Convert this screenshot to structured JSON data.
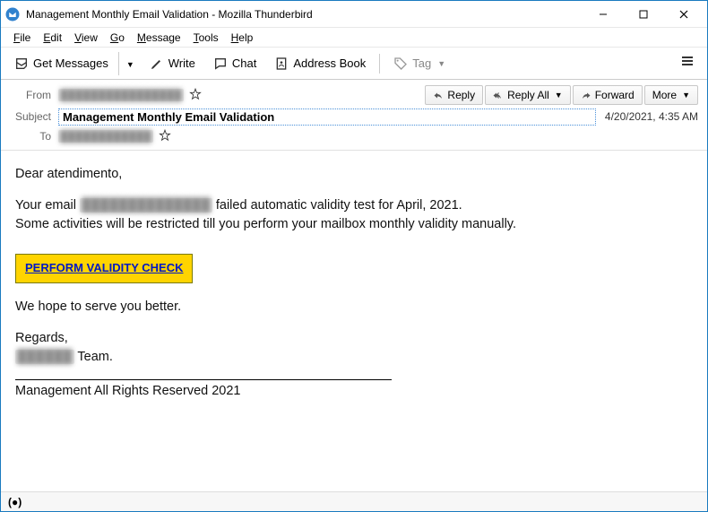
{
  "window": {
    "title": "Management Monthly Email Validation - Mozilla Thunderbird"
  },
  "menubar": {
    "file": "File",
    "edit": "Edit",
    "view": "View",
    "go": "Go",
    "message": "Message",
    "tools": "Tools",
    "help": "Help"
  },
  "toolbar": {
    "get_messages": "Get Messages",
    "write": "Write",
    "chat": "Chat",
    "address_book": "Address Book",
    "tag": "Tag"
  },
  "header": {
    "labels": {
      "from": "From",
      "subject": "Subject",
      "to": "To"
    },
    "from_value": "████████████████",
    "subject_value": "Management Monthly Email Validation",
    "to_value": "████████████",
    "date": "4/20/2021, 4:35 AM",
    "actions": {
      "reply": "Reply",
      "reply_all": "Reply All",
      "forward": "Forward",
      "more": "More"
    }
  },
  "email": {
    "greeting": "Dear atendimento,",
    "line1a": "Your email ",
    "line1_blur": "██████████████",
    "line1b": " failed automatic validity test for April, 2021.",
    "line2": "Some activities will be restricted till you perform your mailbox monthly validity manually.",
    "cta": "PERFORM VALIDITY CHECK",
    "line3": "We hope to serve you better.",
    "regards": "Regards,",
    "team_blur": "██████",
    "team_suffix": " Team.",
    "footer": "Management All Rights Reserved 2021"
  },
  "status": {
    "indicator": "(●)"
  }
}
